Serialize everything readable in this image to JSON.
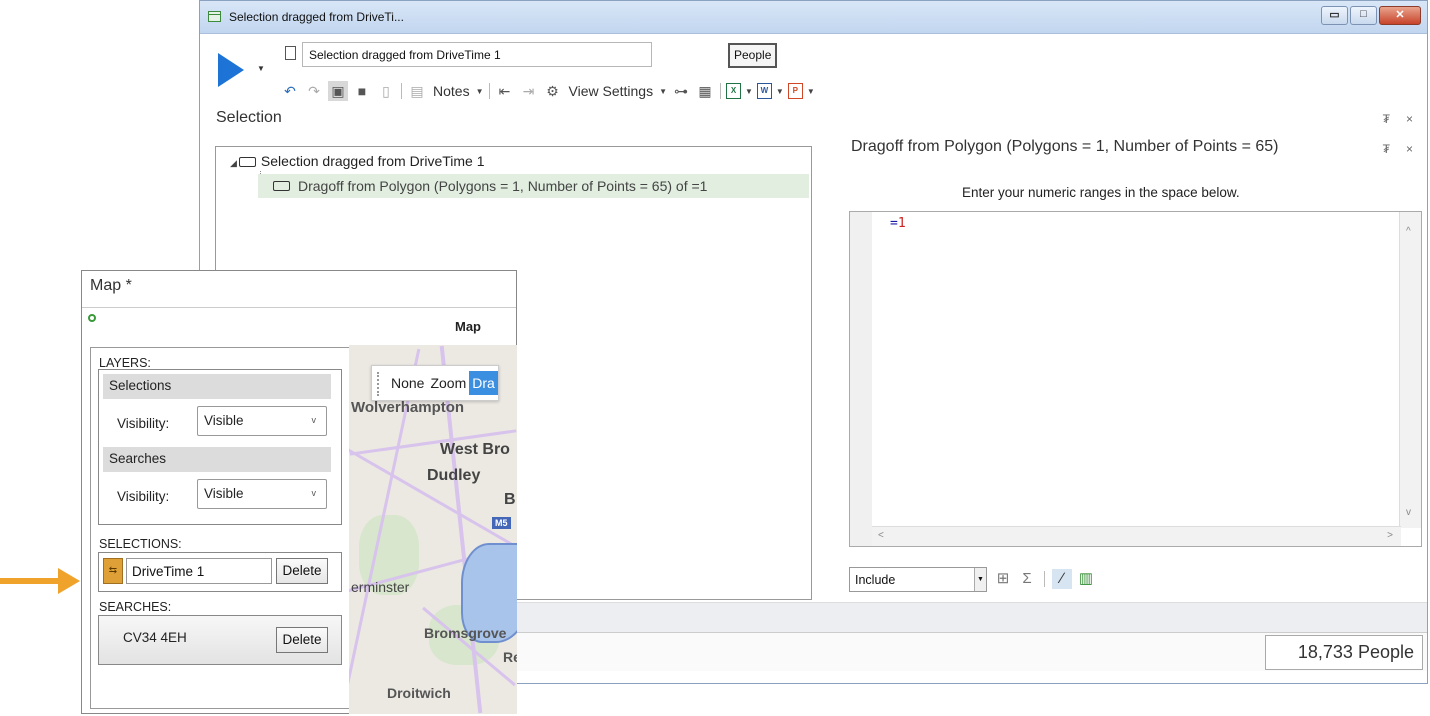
{
  "window": {
    "title": "Selection dragged from DriveTi...",
    "minimize_glyph": "▭",
    "maximize_glyph": "□",
    "close_glyph": "✕"
  },
  "toolbar": {
    "selection_name": "Selection dragged from DriveTime 1",
    "people_label": "People",
    "notes_label": "Notes",
    "view_settings_label": "View Settings",
    "icons": [
      "undo-icon",
      "redo-icon",
      "lock-icon",
      "save-icon",
      "database-icon",
      "clipboard-icon",
      "indent-icon",
      "outdent-icon",
      "settings-icon",
      "tree-icon",
      "table-icon",
      "excel-icon",
      "word-icon",
      "powerpoint-icon"
    ]
  },
  "selection_pane": {
    "label": "Selection",
    "pin_glyph": "₮",
    "close_glyph": "×",
    "tree": [
      {
        "label": "Selection dragged from DriveTime 1"
      },
      {
        "label": "Dragoff from Polygon (Polygons = 1, Number of Points = 65) of =1"
      }
    ]
  },
  "detail_pane": {
    "title": "Dragoff from Polygon (Polygons = 1, Number of Points = 65)",
    "instructions": "Enter your numeric ranges in the space below.",
    "editor_op": "=",
    "editor_value": "1",
    "mode_value": "Include"
  },
  "status": {
    "count": "18,733 People"
  },
  "map_window": {
    "title": "Map *",
    "map_label": "Map",
    "layers_label": "LAYERS:",
    "layers": [
      {
        "name": "Selections",
        "visibility_label": "Visibility:",
        "visibility": "Visible"
      },
      {
        "name": "Searches",
        "visibility_label": "Visibility:",
        "visibility": "Visible"
      }
    ],
    "selections_label": "SELECTIONS:",
    "selection_item": "DriveTime 1",
    "delete_label": "Delete",
    "searches_label": "SEARCHES:",
    "search_item": "CV34 4EH",
    "map_toolbar": [
      "None",
      "Zoom",
      "Dra"
    ],
    "towns": {
      "wolverhampton": "Wolverhampton",
      "west_bromwich": "West Bro",
      "dudley": "Dudley",
      "b": "B",
      "kidderminster": "erminster",
      "bromsgrove": "Bromsgrove",
      "r": "Re",
      "droitwich": "Droitwich"
    },
    "motorway": "M5"
  },
  "colors": {
    "play": "#1d74d6",
    "highlight_row": "#e1eee0",
    "arrow": "#f0a32a",
    "active_tool": "#3b8fe0"
  }
}
